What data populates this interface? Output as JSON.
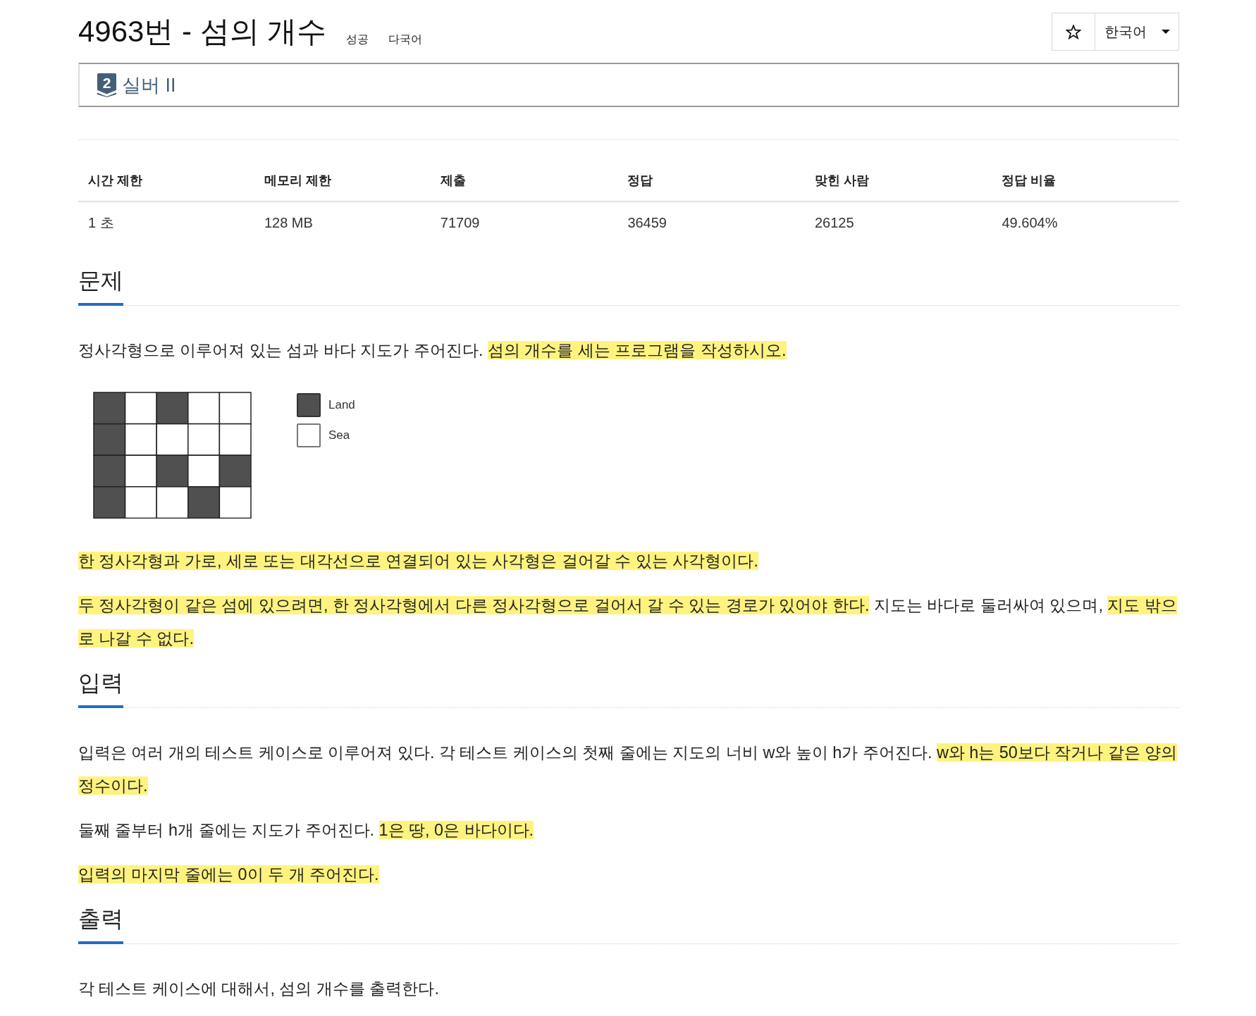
{
  "header": {
    "title": "4963번 - 섬의 개수",
    "tags": [
      "성공",
      "다국어"
    ],
    "language": "한국어"
  },
  "tier": {
    "badge": "2",
    "name": "실버 II"
  },
  "stats": {
    "columns": [
      "시간 제한",
      "메모리 제한",
      "제출",
      "정답",
      "맞힌 사람",
      "정답 비율"
    ],
    "rows": [
      [
        "1 초",
        "128 MB",
        "71709",
        "36459",
        "26125",
        "49.604%"
      ]
    ]
  },
  "sections": [
    {
      "heading": "문제",
      "blocks": [
        {
          "kind": "paragraph",
          "segments": [
            {
              "text": "정사각형으로 이루어져 있는 섬과 바다 지도가 주어진다. ",
              "highlighted": false
            },
            {
              "text": "섬의 개수를 세는 프로그램을 작성하시오.",
              "highlighted": true
            }
          ]
        },
        {
          "kind": "figure",
          "land_rows": [
            [
              true,
              false,
              true,
              false,
              false
            ],
            [
              true,
              false,
              false,
              false,
              false
            ],
            [
              true,
              false,
              true,
              false,
              true
            ],
            [
              true,
              false,
              false,
              true,
              false
            ]
          ],
          "legend": [
            {
              "label": "Land",
              "kind": "land"
            },
            {
              "label": "Sea",
              "kind": "sea"
            }
          ]
        },
        {
          "kind": "paragraph",
          "segments": [
            {
              "text": "한 정사각형과 가로, 세로 또는 대각선으로 연결되어 있는 사각형은 걸어갈 수 있는 사각형이다.",
              "highlighted": true
            }
          ]
        },
        {
          "kind": "paragraph",
          "segments": [
            {
              "text": "두 정사각형이 같은 섬에 있으려면, 한 정사각형에서 다른 정사각형으로 걸어서 갈 수 있는 경로가 있어야 한다.",
              "highlighted": true
            },
            {
              "text": " 지도는 바다로 둘러싸여 있으며, ",
              "highlighted": false
            },
            {
              "text": "지도 밖으로 나갈 수 없다.",
              "highlighted": true
            }
          ]
        }
      ]
    },
    {
      "heading": "입력",
      "blocks": [
        {
          "kind": "paragraph",
          "segments": [
            {
              "text": "입력은 여러 개의 테스트 케이스로 이루어져 있다. 각 테스트 케이스의 첫째 줄에는 지도의 너비 w와 높이 h가 주어진다. ",
              "highlighted": false
            },
            {
              "text": "w와 h는 50보다 작거나 같은 양의 정수이다.",
              "highlighted": true
            }
          ]
        },
        {
          "kind": "paragraph",
          "segments": [
            {
              "text": "둘째 줄부터 h개 줄에는 지도가 주어진다. ",
              "highlighted": false
            },
            {
              "text": "1은 땅, 0은 바다이다.",
              "highlighted": true
            }
          ]
        },
        {
          "kind": "paragraph",
          "segments": [
            {
              "text": "입력의 마지막 줄에는 0이 두 개 주어진다.",
              "highlighted": true
            }
          ]
        }
      ]
    },
    {
      "heading": "출력",
      "blocks": [
        {
          "kind": "paragraph",
          "segments": [
            {
              "text": "각 테스트 케이스에 대해서, 섬의 개수를 출력한다.",
              "highlighted": false
            }
          ]
        }
      ]
    }
  ]
}
